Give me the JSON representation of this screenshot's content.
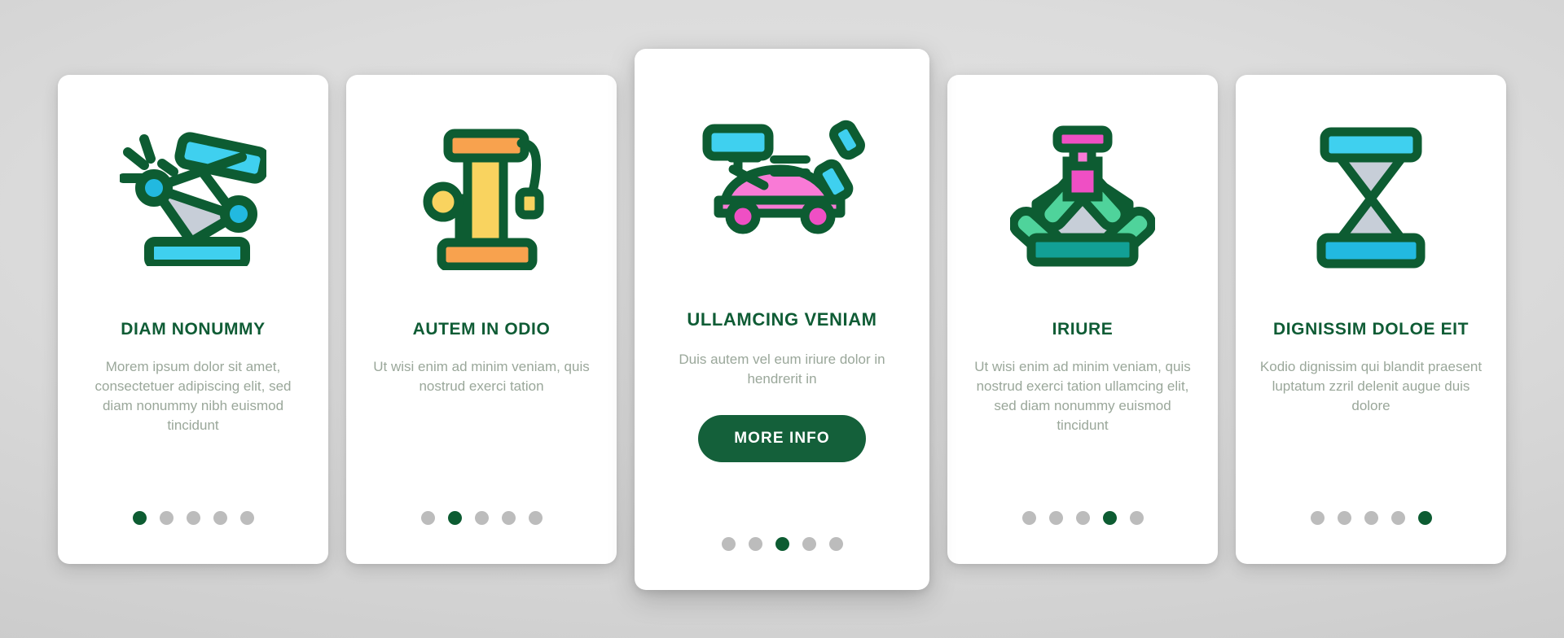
{
  "theme": {
    "background": "#d8d8d8",
    "card_bg": "#ffffff",
    "title_color": "#0f5c35",
    "body_color": "#9aa79a",
    "accent": "#14603a",
    "dot_inactive": "#bcbcbc",
    "dot_active": "#0d5c32",
    "icon_stroke": "#0d5c32",
    "icon_cyan": "#3fd0ef",
    "icon_blue_dark": "#22b9e0",
    "icon_grey": "#c7ced8",
    "icon_orange": "#f6a04a",
    "icon_yellow": "#f9d35f",
    "icon_pink": "#f97ad6",
    "icon_magenta": "#ef4fc4",
    "icon_green": "#4fd39b",
    "icon_teal": "#12a095"
  },
  "cards": [
    {
      "id": "card-diam-nonummy",
      "icon": "car-jack-lift-icon",
      "title": "DIAM NONUMMY",
      "body": "Morem ipsum dolor sit amet, consectetuer adipiscing elit, sed diam nonummy nibh euismod tincidunt",
      "featured": false,
      "dots": {
        "count": 5,
        "active_index": 0
      }
    },
    {
      "id": "card-autem-in-odio",
      "icon": "foot-air-pump-icon",
      "title": "AUTEM IN ODIO",
      "body": "Ut wisi enim ad minim veniam, quis nostrud exerci tation",
      "featured": false,
      "dots": {
        "count": 5,
        "active_index": 1
      }
    },
    {
      "id": "card-ullamcing-veniam",
      "icon": "car-on-jack-icon",
      "title": "ULLAMCING VENIAM",
      "body": "Duis autem vel eum iriure dolor in hendrerit in",
      "featured": true,
      "cta_label": "MORE INFO",
      "dots": {
        "count": 5,
        "active_index": 2
      }
    },
    {
      "id": "card-iriure",
      "icon": "scissor-jack-screw-icon",
      "title": "IRIURE",
      "body": "Ut wisi enim ad minim veniam, quis nostrud exerci tation ullamcing elit, sed diam nonummy euismod tincidunt",
      "featured": false,
      "dots": {
        "count": 5,
        "active_index": 3
      }
    },
    {
      "id": "card-dignissim-doloe-eit",
      "icon": "scissor-lift-icon",
      "title": "DIGNISSIM DOLOE EIT",
      "body": "Kodio dignissim qui blandit praesent luptatum zzril delenit augue duis dolore",
      "featured": false,
      "dots": {
        "count": 5,
        "active_index": 4
      }
    }
  ]
}
